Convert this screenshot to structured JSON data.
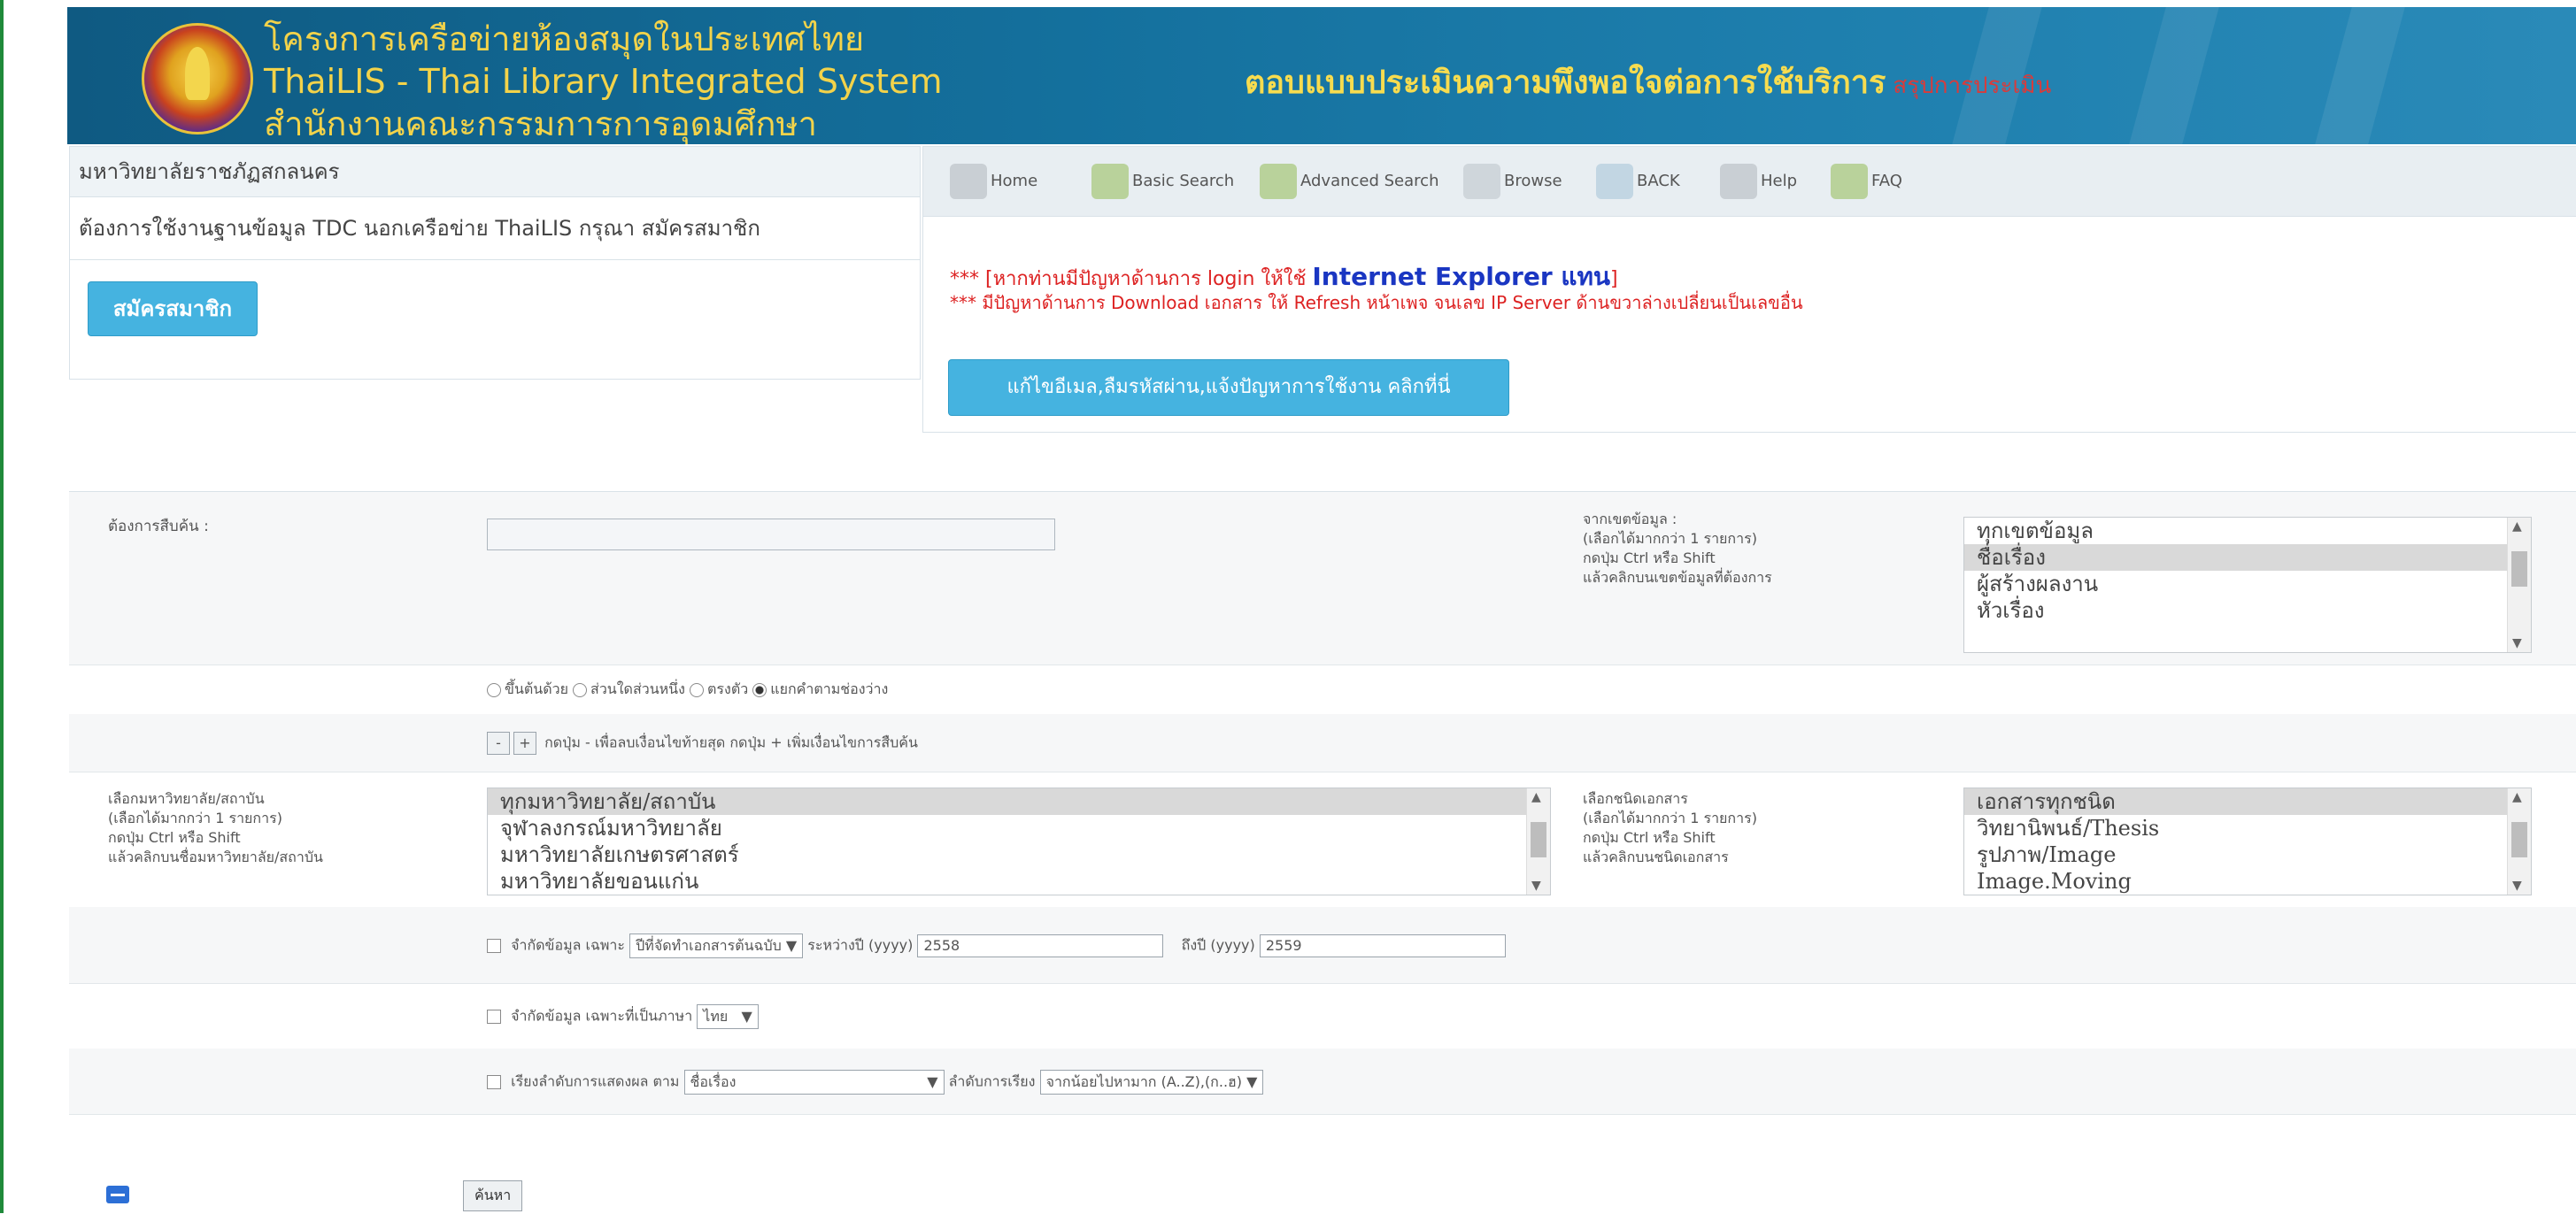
{
  "header": {
    "line1": "โครงการเครือข่ายห้องสมุดในประเทศไทย",
    "line2": "ThaiLIS - Thai Library Integrated System",
    "line3": "สำนักงานคณะกรรมการการอุดมศึกษา",
    "survey": "ตอบแบบประเมินความพึงพอใจต่อการใช้บริการ",
    "survey_sub": "สรุปการประเมิน"
  },
  "left": {
    "institution": "มหาวิทยาลัยราชภัฏสกลนคร",
    "notice": "ต้องการใช้งานฐานข้อมูล TDC นอกเครือข่าย ThaiLIS กรุณา สมัครสมาชิก",
    "register_label": "สมัครสมาชิก"
  },
  "toolbar": {
    "home": "Home",
    "basic": "Basic Search",
    "advanced": "Advanced Search",
    "browse": "Browse",
    "back": "BACK",
    "help": "Help",
    "faq": "FAQ"
  },
  "notices": {
    "n1_prefix": "*** [หากท่านมีปัญหาด้านการ login ให้ใช้",
    "n1_ie": "Internet Explorer แทน",
    "n1_suffix": "]",
    "n2": "*** มีปัญหาด้านการ Download เอกสาร ให้ Refresh หน้าเพจ จนเลข IP Server ด้านขวาล่างเปลี่ยนเป็นเลขอื่น",
    "fix_label": "แก้ไขอีเมล,ลืมรหัสผ่าน,แจ้งปัญหาการใช้งาน คลิกที่นี่"
  },
  "search": {
    "search_label": "ต้องการสืบค้น :",
    "field_help": "จากเขตข้อมูล :\n(เลือกได้มากกว่า 1 รายการ)\nกดปุ่ม Ctrl หรือ Shift\nแล้วคลิกบนเขตข้อมูลที่ต้องการ",
    "fields": [
      "ทุกเขตข้อมูล",
      "ชื่อเรื่อง",
      "ผู้สร้างผลงาน",
      "หัวเรื่อง"
    ],
    "fields_selected": "ชื่อเรื่อง",
    "radio_opts": [
      "ขึ้นต้นด้วย",
      "ส่วนใดส่วนหนึ่ง",
      "ตรงตัว",
      "แยกคำตามช่องว่าง"
    ],
    "plusminus_help": "กดปุ่ม - เพื่อลบเงื่อนไขท้ายสุด กดปุ่ม + เพิ่มเงื่อนไขการสืบค้น",
    "inst_help": "เลือกมหาวิทยาลัย/สถาบัน\n(เลือกได้มากกว่า 1 รายการ)\nกดปุ่ม Ctrl หรือ Shift\nแล้วคลิกบนชื่อมหาวิทยาลัย/สถาบัน",
    "institutions": [
      "ทุกมหาวิทยาลัย/สถาบัน",
      "จุฬาลงกรณ์มหาวิทยาลัย",
      "มหาวิทยาลัยเกษตรศาสตร์",
      "มหาวิทยาลัยขอนแก่น"
    ],
    "doc_help": "เลือกชนิดเอกสาร\n(เลือกได้มากกว่า 1 รายการ)\nกดปุ่ม Ctrl หรือ Shift\nแล้วคลิกบนชนิดเอกสาร",
    "doctypes": [
      "เอกสารทุกชนิด",
      "วิทยานิพนธ์/Thesis",
      "รูปภาพ/Image",
      "Image.Moving"
    ],
    "limit_year_label": "จำกัดข้อมูล เฉพาะ",
    "limit_year_select": "ปีที่จัดทำเอกสารต้นฉบับ",
    "between_label": "ระหว่างปี (yyyy)",
    "year_from": "2558",
    "to_label": "ถึงปี (yyyy)",
    "year_to": "2559",
    "limit_lang_label": "จำกัดข้อมูล เฉพาะที่เป็นภาษา",
    "lang_value": "ไทย",
    "sort_label": "เรียงลำดับการแสดงผล ตาม",
    "sort_value": "ชื่อเรื่อง",
    "order_label": "ลำดับการเรียง",
    "order_value": "จากน้อยไปหามาก (A..Z),(ก..ฮ)",
    "submit_label": "ค้นหา"
  },
  "colors": {
    "header": "#14709d",
    "accent": "#45b3e0",
    "alert": "#dd2222"
  }
}
